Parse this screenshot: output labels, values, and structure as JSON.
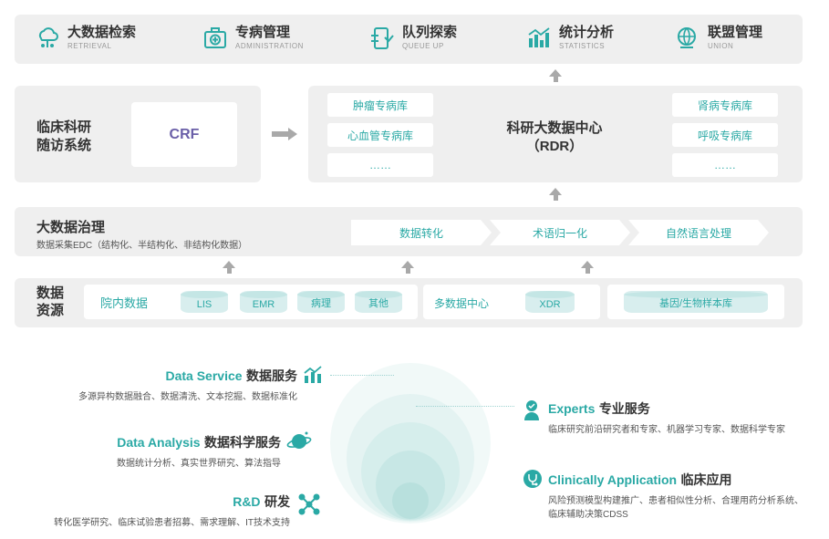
{
  "nav": [
    {
      "zh": "大数据检索",
      "en": "RETRIEVAL",
      "icon": "retrieval-icon"
    },
    {
      "zh": "专病管理",
      "en": "ADMINISTRATION",
      "icon": "medical-kit-icon"
    },
    {
      "zh": "队列探索",
      "en": "QUEUE UP",
      "icon": "queue-icon"
    },
    {
      "zh": "统计分析",
      "en": "STATISTICS",
      "icon": "bar-chart-icon"
    },
    {
      "zh": "联盟管理",
      "en": "UNION",
      "icon": "globe-icon"
    }
  ],
  "crf_system": {
    "title_line1": "临床科研",
    "title_line2": "随访系统",
    "crf": "CRF"
  },
  "rdr": {
    "title": "科研大数据中心",
    "subtitle": "（RDR）",
    "left": [
      "肿瘤专病库",
      "心血管专病库",
      "……"
    ],
    "right": [
      "肾病专病库",
      "呼吸专病库",
      "……"
    ]
  },
  "governance": {
    "title": "大数据治理",
    "subtitle": "数据采集EDC（结构化、半结构化、非结构化数据）",
    "steps": [
      "数据转化",
      "术语归一化",
      "自然语言处理"
    ]
  },
  "resources": {
    "title_line1": "数据",
    "title_line2": "资源",
    "hospital": {
      "label": "院内数据",
      "items": [
        "LIS",
        "EMR",
        "病理",
        "其他"
      ]
    },
    "multi": {
      "label": "多数据中心",
      "items": [
        "XDR"
      ]
    },
    "bio": {
      "items": [
        "基因/生物样本库"
      ]
    }
  },
  "services": [
    {
      "en": "Data Service",
      "zh": "数据服务",
      "desc": "多源异构数据融合、数据清洗、文本挖掘、数据标准化",
      "icon": "data-service-icon"
    },
    {
      "en": "Data Analysis",
      "zh": "数据科学服务",
      "desc": "数据统计分析、真实世界研究、算法指导",
      "icon": "planet-icon"
    },
    {
      "en": "R&D",
      "zh": "研发",
      "desc": "转化医学研究、临床试验患者招募、需求理解、IT技术支持",
      "icon": "molecule-icon"
    },
    {
      "en": "Experts",
      "zh": "专业服务",
      "desc": "临床研究前沿研究者和专家、机器学习专家、数据科学专家",
      "icon": "expert-icon"
    },
    {
      "en": "Clinically Application",
      "zh": "临床应用",
      "desc_line1": "风险预测模型构建推广、患者相似性分析、合理用药分析系统、",
      "desc_line2": "临床辅助决策CDSS",
      "icon": "stethoscope-icon"
    }
  ],
  "colors": {
    "accent": "#2aa9a5",
    "panel": "#efefef",
    "arrow": "#a9a9a9"
  }
}
